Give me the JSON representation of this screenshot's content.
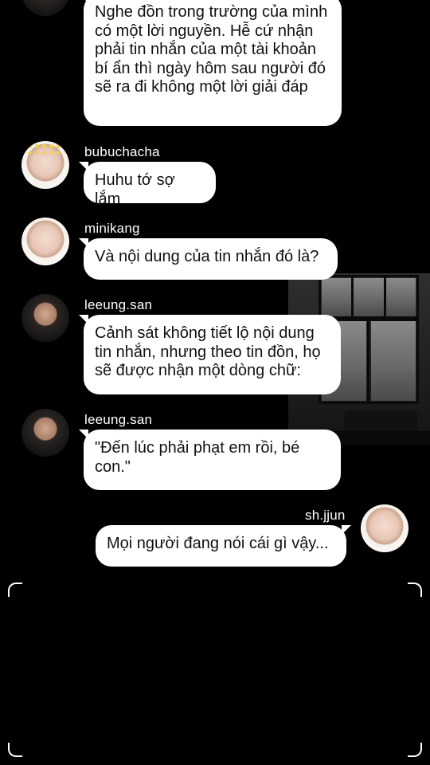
{
  "messages": [
    {
      "sender": "",
      "text": "Nghe đồn trong trường của mình có một lời nguyền. Hễ cứ nhận phải tin nhắn của một tài khoản bí ẩn thì ngày hôm sau người đó sẽ ra đi không một lời giải đáp",
      "side": "left"
    },
    {
      "sender": "bubuchacha",
      "text": "Huhu tớ sợ lắm",
      "side": "left"
    },
    {
      "sender": "minikang",
      "text": "Và nội dung của tin nhắn đó là?",
      "side": "left"
    },
    {
      "sender": "leeung.san",
      "text": "Cảnh sát không tiết lộ nội dung tin nhắn, nhưng theo tin đồn, họ sẽ được nhận một dòng chữ:",
      "side": "left"
    },
    {
      "sender": "leeung.san",
      "text": "\"Đến lúc phải phạt em rồi, bé con.\"",
      "side": "left"
    },
    {
      "sender": "sh.jjun",
      "text": "Mọi người đang nói cái gì vậy...",
      "side": "right"
    }
  ],
  "colors": {
    "background": "#000000",
    "bubble": "#ffffff",
    "text": "#111111",
    "name": "#ffffff"
  }
}
